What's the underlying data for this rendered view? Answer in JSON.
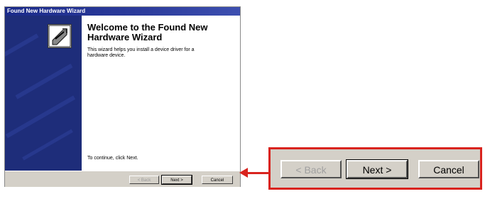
{
  "window": {
    "title": "Found New Hardware Wizard",
    "heading": "Welcome to the Found New Hardware Wizard",
    "description": "This wizard helps you install a device driver for a hardware device.",
    "continue_text": "To continue, click Next."
  },
  "buttons": {
    "back": "< Back",
    "next": "Next >",
    "cancel": "Cancel"
  },
  "zoom": {
    "back": "< Back",
    "next": "Next >",
    "cancel": "Cancel"
  },
  "icons": [
    "hardware-wizard-icon",
    "red-arrow-icon",
    "pointer-arrow-icon"
  ],
  "colors": {
    "titlebar": "#1a2a8a",
    "side_panel": "#1e2d7a",
    "highlight": "#d9231e",
    "dialog_face": "#d4d0c8"
  }
}
